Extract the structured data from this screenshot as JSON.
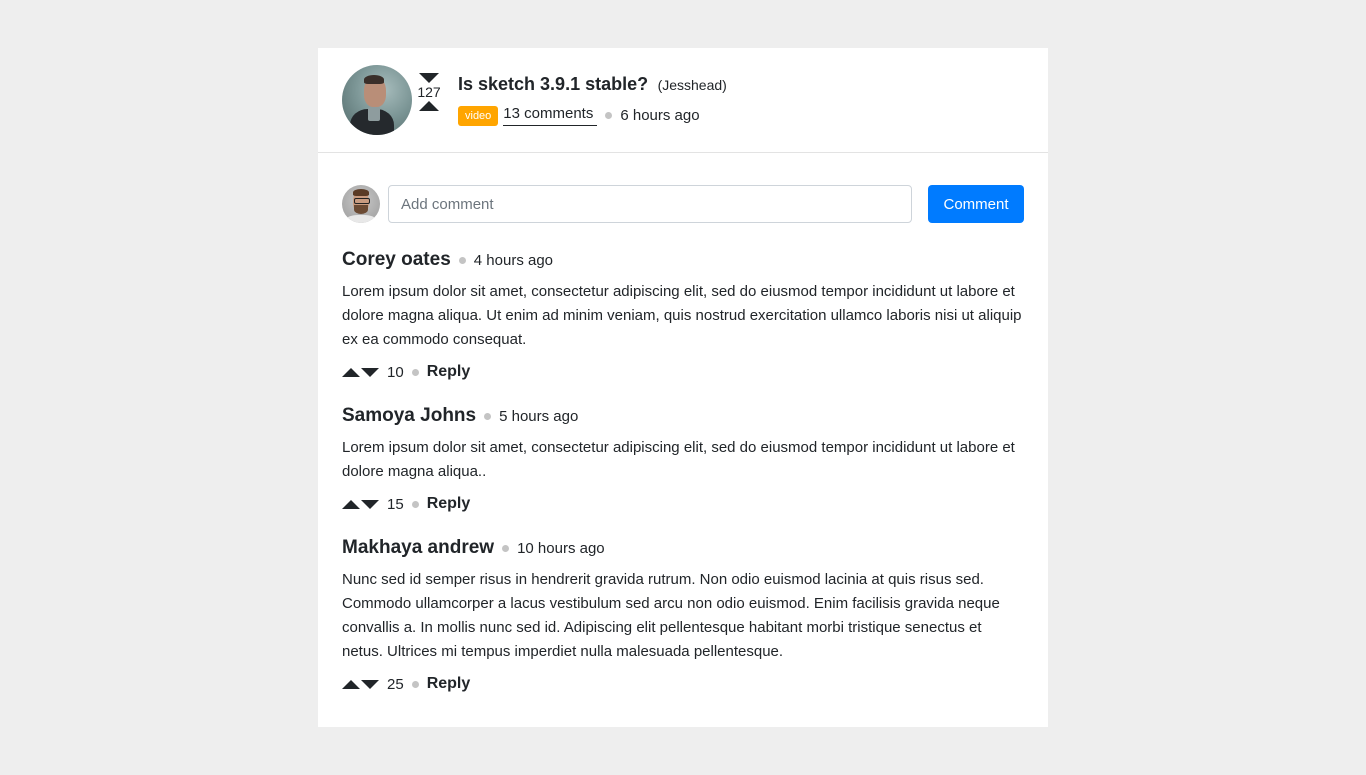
{
  "post": {
    "title": "Is sketch 3.9.1 stable?",
    "author": "(Jesshead)",
    "votes": "127",
    "badge": "video",
    "comments_link": "13 comments",
    "time": "6 hours ago",
    "colors": {
      "badge": "#ffa500",
      "primary": "#007bff"
    }
  },
  "comment_form": {
    "placeholder": "Add comment",
    "value": "",
    "button_label": "Comment"
  },
  "comments": [
    {
      "name": "Corey oates",
      "time": "4 hours ago",
      "body": "Lorem ipsum dolor sit amet, consectetur adipiscing elit, sed do eiusmod tempor incididunt ut labore et dolore magna aliqua. Ut enim ad minim veniam, quis nostrud exercitation ullamco laboris nisi ut aliquip ex ea commodo consequat.",
      "votes": "10",
      "reply_label": "Reply"
    },
    {
      "name": "Samoya Johns",
      "time": "5 hours ago",
      "body": "Lorem ipsum dolor sit amet, consectetur adipiscing elit, sed do eiusmod tempor incididunt ut labore et dolore magna aliqua..",
      "votes": "15",
      "reply_label": "Reply"
    },
    {
      "name": "Makhaya andrew",
      "time": "10 hours ago",
      "body": "Nunc sed id semper risus in hendrerit gravida rutrum. Non odio euismod lacinia at quis risus sed. Commodo ullamcorper a lacus vestibulum sed arcu non odio euismod. Enim facilisis gravida neque convallis a. In mollis nunc sed id. Adipiscing elit pellentesque habitant morbi tristique senectus et netus. Ultrices mi tempus imperdiet nulla malesuada pellentesque.",
      "votes": "25",
      "reply_label": "Reply"
    }
  ]
}
